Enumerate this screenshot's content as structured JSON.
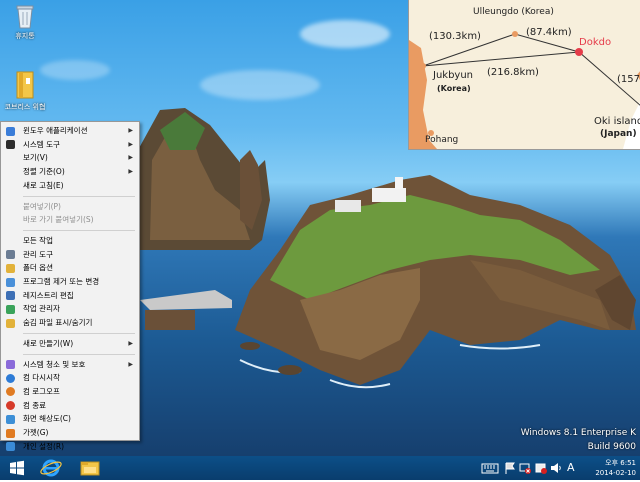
{
  "desktop_icons": [
    {
      "label": "휴지통",
      "icon": "recycle-bin-icon"
    },
    {
      "label": "코브리스 위협",
      "icon": "folder-icon"
    }
  ],
  "map": {
    "labels": {
      "ulleungdo": "Ulleungdo (Korea)",
      "dist_left": "(130.3km)",
      "dist_mid": "(87.4km)",
      "dokdo": "Dokdo",
      "jukbyun": "Jukbyun",
      "jukbyun_country": "(Korea)",
      "dist_bottom": "(216.8km)",
      "dist_right": "(157",
      "oki": "Oki island",
      "oki_country": "(Japan)",
      "pohang": "Pohang"
    },
    "colors": {
      "dokdo": "#e53c4a",
      "line": "#333333",
      "land": "#e99b62"
    }
  },
  "context_menu": {
    "items": [
      {
        "label": "윈도우 애플리케이션",
        "submenu": true,
        "disabled": false,
        "icon": "windows-apps-icon"
      },
      {
        "label": "시스템 도구",
        "submenu": true,
        "disabled": false,
        "icon": "system-tools-icon"
      },
      {
        "label": "보기(V)",
        "submenu": true,
        "disabled": false,
        "icon": ""
      },
      {
        "label": "정렬 기준(O)",
        "submenu": true,
        "disabled": false,
        "icon": ""
      },
      {
        "label": "새로 고침(E)",
        "submenu": false,
        "disabled": false,
        "icon": ""
      },
      {
        "label": "붙여넣기(P)",
        "submenu": false,
        "disabled": true,
        "icon": ""
      },
      {
        "label": "바로 가기 붙여넣기(S)",
        "submenu": false,
        "disabled": true,
        "icon": ""
      },
      {
        "label": "모든 작업",
        "submenu": false,
        "disabled": false,
        "icon": ""
      },
      {
        "label": "관리 도구",
        "submenu": false,
        "disabled": false,
        "icon": "admin-tools-icon"
      },
      {
        "label": "폴더 옵션",
        "submenu": false,
        "disabled": false,
        "icon": "folder-options-icon"
      },
      {
        "label": "프로그램 제거 또는 변경",
        "submenu": false,
        "disabled": false,
        "icon": "programs-icon"
      },
      {
        "label": "레지스트리 편집",
        "submenu": false,
        "disabled": false,
        "icon": "registry-icon"
      },
      {
        "label": "작업 관리자",
        "submenu": false,
        "disabled": false,
        "icon": "task-manager-icon"
      },
      {
        "label": "숨김 파일 표시/숨기기",
        "submenu": false,
        "disabled": false,
        "icon": "hidden-files-icon"
      },
      {
        "label": "새로 만들기(W)",
        "submenu": true,
        "disabled": false,
        "icon": ""
      },
      {
        "label": "시스템 청소 및 보호",
        "submenu": true,
        "disabled": false,
        "icon": "system-clean-icon"
      },
      {
        "label": "컴 다시시작",
        "submenu": false,
        "disabled": false,
        "icon": "restart-icon"
      },
      {
        "label": "컴 로그오프",
        "submenu": false,
        "disabled": false,
        "icon": "logoff-icon"
      },
      {
        "label": "컴 종료",
        "submenu": false,
        "disabled": false,
        "icon": "shutdown-icon"
      },
      {
        "label": "화면 해상도(C)",
        "submenu": false,
        "disabled": false,
        "icon": "display-icon"
      },
      {
        "label": "가젯(G)",
        "submenu": false,
        "disabled": false,
        "icon": "gadget-icon"
      },
      {
        "label": "개인 설정(R)",
        "submenu": false,
        "disabled": false,
        "icon": "personalize-icon"
      }
    ]
  },
  "watermark": {
    "line1": "Windows 8.1 Enterprise K",
    "line2": "Build 9600"
  },
  "taskbar": {
    "start_icon": "windows-start-icon",
    "pinned": [
      {
        "name": "internet-explorer-icon"
      },
      {
        "name": "file-explorer-icon"
      }
    ],
    "tray": {
      "ime_mode": "A",
      "time": "오후 6:51",
      "date": "2014-02-10"
    }
  },
  "colors": {
    "taskbar": "#0b4679",
    "menu_bg": "#f2f2f2",
    "sea": "#1c5a93",
    "sky": "#63b9f0"
  }
}
